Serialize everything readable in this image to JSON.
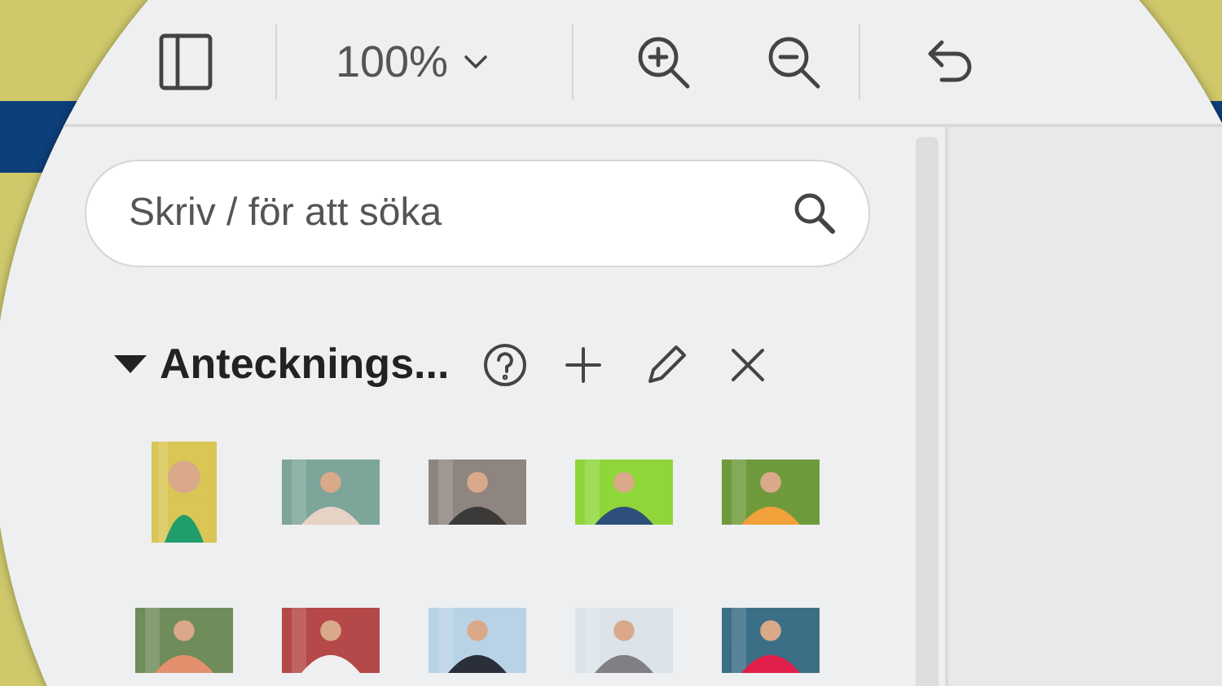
{
  "toolbar": {
    "zoom": "100%"
  },
  "search": {
    "placeholder": "Skriv / för att söka"
  },
  "section": {
    "title": "Antecknings...",
    "expanded": true
  }
}
